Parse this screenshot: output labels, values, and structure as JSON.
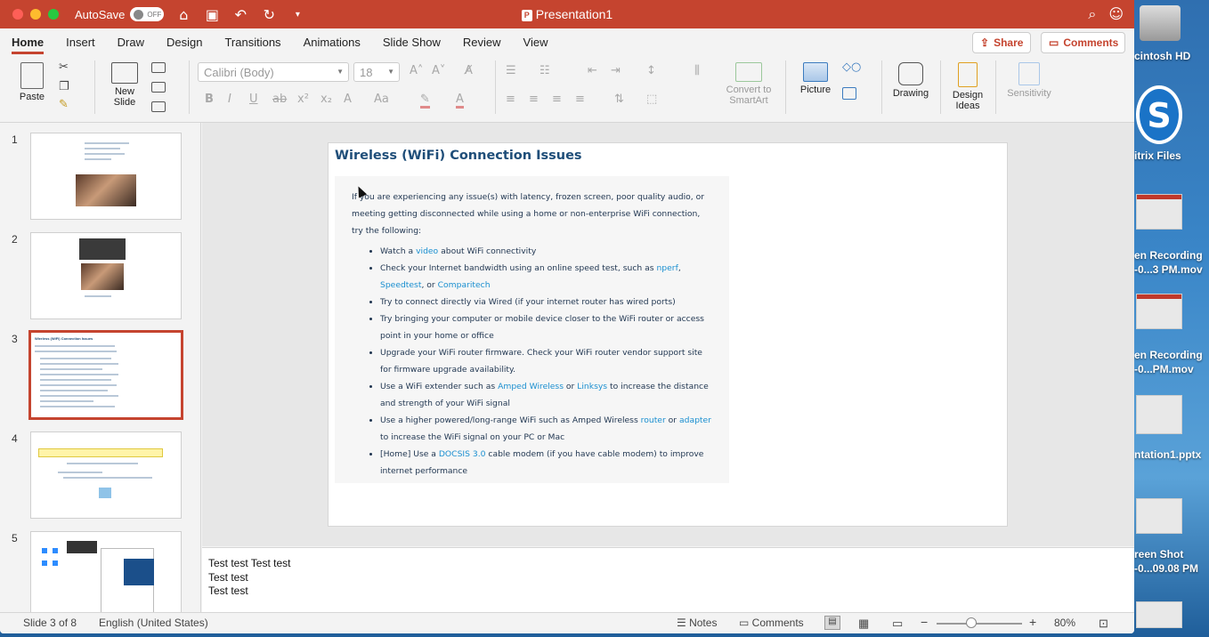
{
  "window": {
    "autosave_label": "AutoSave",
    "autosave_state": "OFF",
    "title": "Presentation1"
  },
  "tabs": [
    "Home",
    "Insert",
    "Draw",
    "Design",
    "Transitions",
    "Animations",
    "Slide Show",
    "Review",
    "View"
  ],
  "actions": {
    "share": "Share",
    "comments": "Comments"
  },
  "ribbon": {
    "paste": "Paste",
    "new_slide_line1": "New",
    "new_slide_line2": "Slide",
    "font_name": "Calibri (Body)",
    "font_size": "18",
    "convert_line1": "Convert to",
    "convert_line2": "SmartArt",
    "picture": "Picture",
    "drawing": "Drawing",
    "design_ideas_line1": "Design",
    "design_ideas_line2": "Ideas",
    "sensitivity": "Sensitivity"
  },
  "thumbnails": [
    {
      "number": "1"
    },
    {
      "number": "2"
    },
    {
      "number": "3",
      "title": "Wireless (WiFi) Connection Issues"
    },
    {
      "number": "4"
    },
    {
      "number": "5"
    }
  ],
  "slide": {
    "title": "Wireless (WiFi) Connection Issues",
    "intro": "If you are experiencing any issue(s) with latency, frozen screen, poor quality audio, or meeting getting disconnected while using a home or non-enterprise WiFi connection, try the following:",
    "b1_a": "Watch a ",
    "b1_link": "video",
    "b1_b": " about WiFi connectivity",
    "b2_a": "Check your Internet bandwidth using an online speed test, such as ",
    "b2_l1": "nperf",
    "b2_sep1": ", ",
    "b2_l2": "Speedtest",
    "b2_sep2": ", or ",
    "b2_l3": "Comparitech",
    "b3": "Try to connect directly via Wired (if your internet router has wired ports)",
    "b4": "Try bringing your computer or mobile device closer to the WiFi router or access point  in your home or office",
    "b5": "Upgrade your WiFi router firmware. Check your WiFi router vendor support site for firmware upgrade availability.",
    "b6_a": "Use a WiFi extender such as ",
    "b6_l1": "Amped Wireless",
    "b6_or": " or ",
    "b6_l2": "Linksys",
    "b6_b": " to increase the distance and strength of your WiFi signal",
    "b7_a": "Use a higher powered/long-range WiFi such as Amped Wireless ",
    "b7_l1": "router",
    "b7_or": " or ",
    "b7_l2": "adapter",
    "b7_b": " to increase the WiFi signal on your PC or Mac",
    "b8_a": "[Home] Use a ",
    "b8_l1": "DOCSIS 3.0",
    "b8_b": " cable modem (if you have cable modem) to improve internet performance"
  },
  "notes": [
    "Test test Test test",
    "Test test",
    "Test test"
  ],
  "status": {
    "slide_counter": "Slide 3 of 8",
    "language": "English (United States)",
    "notes": "Notes",
    "comments": "Comments",
    "zoom": "80%"
  },
  "desktop": {
    "hd": "cintosh HD",
    "citrix": "itrix Files",
    "rec1_a": "en Recording",
    "rec1_b": "-0...3 PM.mov",
    "rec2_a": "en Recording",
    "rec2_b": "-0...PM.mov",
    "pptx": "ntation1.pptx",
    "shot_a": "reen Shot",
    "shot_b": "-0...09.08 PM"
  },
  "colors": {
    "accent": "#c5442f",
    "slide_title": "#1f4e79",
    "link": "#1a8fd0"
  }
}
